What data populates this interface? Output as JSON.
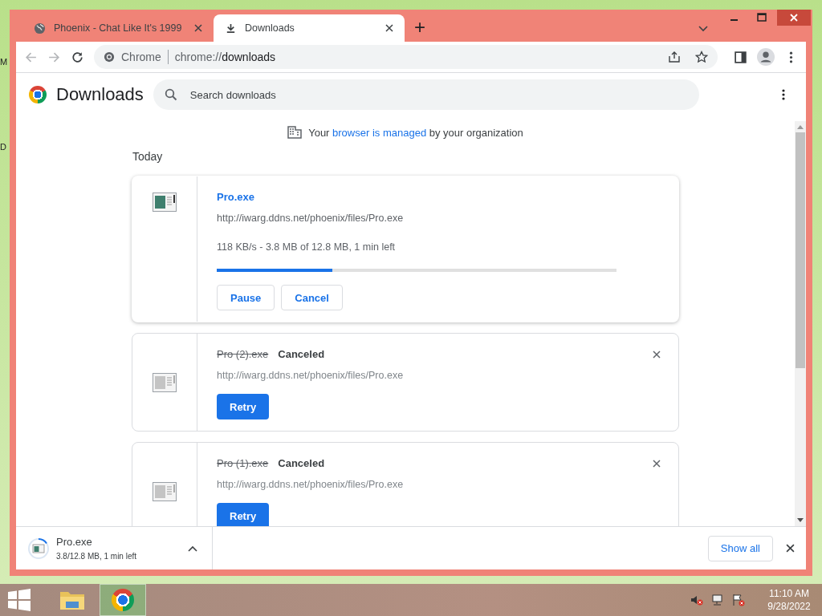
{
  "desktop": {
    "labels": [
      "M",
      "D"
    ]
  },
  "tabs": [
    {
      "title": "Phoenix - Chat Like It's 1999",
      "kind": "web",
      "selected": false
    },
    {
      "title": "Downloads",
      "kind": "downloads",
      "selected": true
    }
  ],
  "new_tab": "+",
  "omnibox": {
    "chip": "Chrome",
    "url_scheme": "chrome://",
    "url_path": "downloads"
  },
  "page": {
    "title": "Downloads",
    "search": {
      "placeholder": "Search downloads"
    },
    "managed_notice": {
      "before": "Your ",
      "link": "browser is managed",
      "after": " by your organization"
    },
    "section": "Today",
    "downloads": [
      {
        "kind": "active",
        "name": "Pro.exe",
        "url": "http://iwarg.ddns.net/phoenix/files/Pro.exe",
        "progress_text": "118 KB/s - 3.8 MB of 12.8 MB, 1 min left",
        "level": 0.29,
        "buttons": [
          "Pause",
          "Cancel"
        ]
      },
      {
        "kind": "canceled",
        "name": "Pro (2).exe",
        "status": "Canceled",
        "url": "http://iwarg.ddns.net/phoenix/files/Pro.exe",
        "buttons": [
          "Retry"
        ]
      },
      {
        "kind": "canceled",
        "name": "Pro (1).exe",
        "status": "Canceled",
        "url": "http://iwarg.ddns.net/phoenix/files/Pro.exe",
        "buttons": [
          "Retry"
        ]
      }
    ]
  },
  "shelf": {
    "name": "Pro.exe",
    "status": "3.8/12.8 MB, 1 min left",
    "show_all": "Show all"
  },
  "taskbar": {
    "apps": [
      {
        "kind": "explorer",
        "selected": false
      },
      {
        "kind": "chrome",
        "selected": true
      }
    ],
    "time": "11:10 AM",
    "date": "9/28/2022"
  }
}
